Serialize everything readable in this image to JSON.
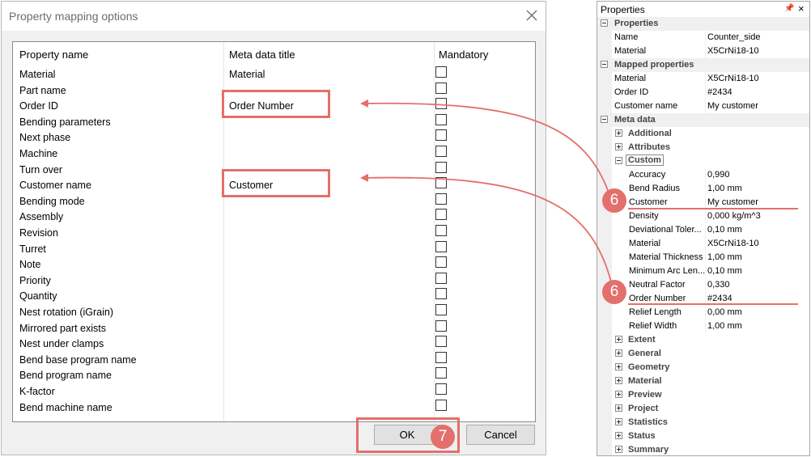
{
  "dialog": {
    "title": "Property mapping options",
    "headers": {
      "property": "Property name",
      "meta": "Meta data title",
      "mandatory": "Mandatory"
    },
    "rows": [
      {
        "name": "Material",
        "meta": "Material"
      },
      {
        "name": "Part name",
        "meta": ""
      },
      {
        "name": "Order ID",
        "meta": "Order Number"
      },
      {
        "name": "Bending parameters",
        "meta": ""
      },
      {
        "name": "Next phase",
        "meta": ""
      },
      {
        "name": "Machine",
        "meta": ""
      },
      {
        "name": "Turn over",
        "meta": ""
      },
      {
        "name": "Customer name",
        "meta": "Customer"
      },
      {
        "name": "Bending mode",
        "meta": ""
      },
      {
        "name": "Assembly",
        "meta": ""
      },
      {
        "name": "Revision",
        "meta": ""
      },
      {
        "name": "Turret",
        "meta": ""
      },
      {
        "name": "Note",
        "meta": ""
      },
      {
        "name": "Priority",
        "meta": ""
      },
      {
        "name": "Quantity",
        "meta": ""
      },
      {
        "name": "Nest rotation (iGrain)",
        "meta": ""
      },
      {
        "name": "Mirrored part exists",
        "meta": ""
      },
      {
        "name": "Nest under clamps",
        "meta": ""
      },
      {
        "name": "Bend base program name",
        "meta": ""
      },
      {
        "name": "Bend program name",
        "meta": ""
      },
      {
        "name": "K-factor",
        "meta": ""
      },
      {
        "name": "Bend machine name",
        "meta": ""
      }
    ],
    "ok_label": "OK",
    "cancel_label": "Cancel"
  },
  "panel": {
    "title": "Properties",
    "rows": [
      {
        "type": "cat",
        "label": "Properties",
        "state": "open"
      },
      {
        "type": "leaf",
        "label": "Name",
        "value": "Counter_side"
      },
      {
        "type": "leaf",
        "label": "Material",
        "value": "X5CrNi18-10"
      },
      {
        "type": "cat",
        "label": "Mapped properties",
        "state": "open"
      },
      {
        "type": "leaf",
        "label": "Material",
        "value": "X5CrNi18-10"
      },
      {
        "type": "leaf",
        "label": "Order ID",
        "value": "#2434"
      },
      {
        "type": "leaf",
        "label": "Customer name",
        "value": "My customer"
      },
      {
        "type": "cat",
        "label": "Meta data",
        "state": "open"
      },
      {
        "type": "sub",
        "label": "Additional",
        "state": "closed"
      },
      {
        "type": "sub",
        "label": "Attributes",
        "state": "closed"
      },
      {
        "type": "sub",
        "label": "Custom",
        "state": "open",
        "boxed": true
      },
      {
        "type": "item",
        "label": "Accuracy",
        "value": "0,990"
      },
      {
        "type": "item",
        "label": "Bend Radius",
        "value": "1,00 mm"
      },
      {
        "type": "item",
        "label": "Customer",
        "value": "My customer"
      },
      {
        "type": "item",
        "label": "Density",
        "value": "0,000 kg/m^3"
      },
      {
        "type": "item",
        "label": "Deviational Toler...",
        "value": "0,10 mm"
      },
      {
        "type": "item",
        "label": "Material",
        "value": "X5CrNi18-10"
      },
      {
        "type": "item",
        "label": "Material Thickness",
        "value": "1,00 mm"
      },
      {
        "type": "item",
        "label": "Minimum Arc Len...",
        "value": "0,10 mm"
      },
      {
        "type": "item",
        "label": "Neutral Factor",
        "value": "0,330"
      },
      {
        "type": "item",
        "label": "Order Number",
        "value": "#2434"
      },
      {
        "type": "item",
        "label": "Relief Length",
        "value": "0,00 mm"
      },
      {
        "type": "item",
        "label": "Relief Width",
        "value": "1,00 mm"
      },
      {
        "type": "sub",
        "label": "Extent",
        "state": "closed"
      },
      {
        "type": "sub",
        "label": "General",
        "state": "closed"
      },
      {
        "type": "sub",
        "label": "Geometry",
        "state": "closed"
      },
      {
        "type": "sub",
        "label": "Material",
        "state": "closed"
      },
      {
        "type": "sub",
        "label": "Preview",
        "state": "closed"
      },
      {
        "type": "sub",
        "label": "Project",
        "state": "closed"
      },
      {
        "type": "sub",
        "label": "Statistics",
        "state": "closed"
      },
      {
        "type": "sub",
        "label": "Status",
        "state": "closed"
      },
      {
        "type": "sub",
        "label": "Summary",
        "state": "closed"
      }
    ]
  },
  "annotations": {
    "badge_customer": "6",
    "badge_order": "6",
    "badge_ok": "7",
    "accent_color": "#e3706c"
  }
}
